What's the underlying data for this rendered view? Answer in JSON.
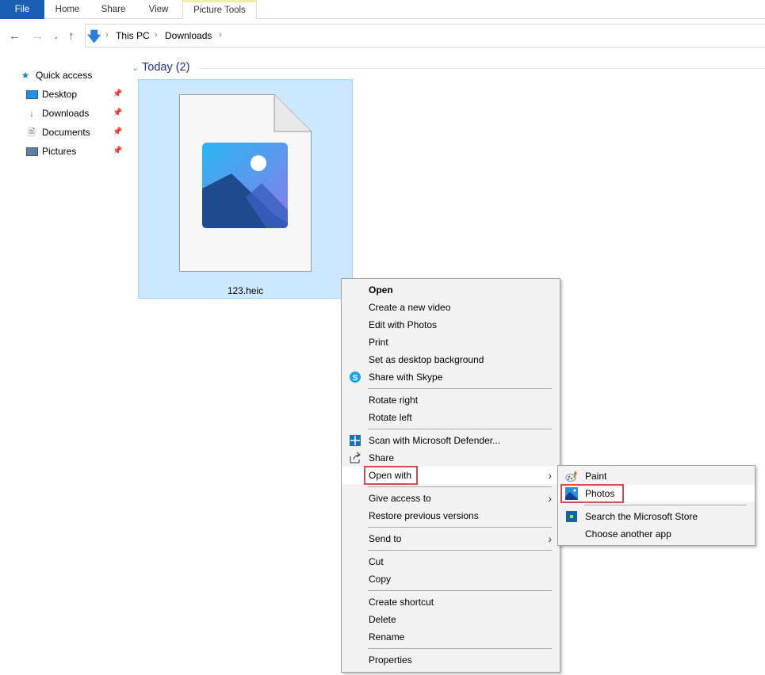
{
  "ribbon": {
    "tabs": [
      "File",
      "Home",
      "Share",
      "View",
      "Picture Tools"
    ]
  },
  "address": {
    "crumbs": [
      "This PC",
      "Downloads"
    ]
  },
  "sidebar": {
    "quick_access": "Quick access",
    "items": [
      {
        "label": "Desktop",
        "icon": "desktop-icon"
      },
      {
        "label": "Downloads",
        "icon": "download-icon"
      },
      {
        "label": "Documents",
        "icon": "documents-icon"
      },
      {
        "label": "Pictures",
        "icon": "pictures-icon"
      }
    ]
  },
  "content": {
    "group": "Today (2)",
    "file_name": "123.heic"
  },
  "context_menu": {
    "items": [
      {
        "label": "Open",
        "bold": true
      },
      {
        "label": "Create a new video"
      },
      {
        "label": "Edit with Photos"
      },
      {
        "label": "Print"
      },
      {
        "label": "Set as desktop background"
      },
      {
        "label": "Share with Skype",
        "icon": "skype-icon"
      },
      {
        "sep": true
      },
      {
        "label": "Rotate right"
      },
      {
        "label": "Rotate left"
      },
      {
        "sep": true
      },
      {
        "label": "Scan with Microsoft Defender...",
        "icon": "defender-icon"
      },
      {
        "label": "Share",
        "icon": "share-icon"
      },
      {
        "label": "Open with",
        "submenu": true,
        "hover": true,
        "highlight": true
      },
      {
        "sep": true
      },
      {
        "label": "Give access to",
        "submenu": true
      },
      {
        "label": "Restore previous versions"
      },
      {
        "sep": true
      },
      {
        "label": "Send to",
        "submenu": true
      },
      {
        "sep": true
      },
      {
        "label": "Cut"
      },
      {
        "label": "Copy"
      },
      {
        "sep": true
      },
      {
        "label": "Create shortcut"
      },
      {
        "label": "Delete"
      },
      {
        "label": "Rename"
      },
      {
        "sep": true
      },
      {
        "label": "Properties"
      }
    ]
  },
  "open_with_menu": {
    "items": [
      {
        "label": "Paint",
        "icon": "paint-icon"
      },
      {
        "label": "Photos",
        "icon": "photos-icon",
        "hover": true,
        "highlight": true
      },
      {
        "sep": true
      },
      {
        "label": "Search the Microsoft Store",
        "icon": "store-icon"
      },
      {
        "label": "Choose another app"
      }
    ]
  },
  "colors": {
    "accent": "#1a5fb4",
    "selection": "#cce8ff",
    "highlight_box": "#e0474c",
    "group_header": "#1e3287"
  }
}
